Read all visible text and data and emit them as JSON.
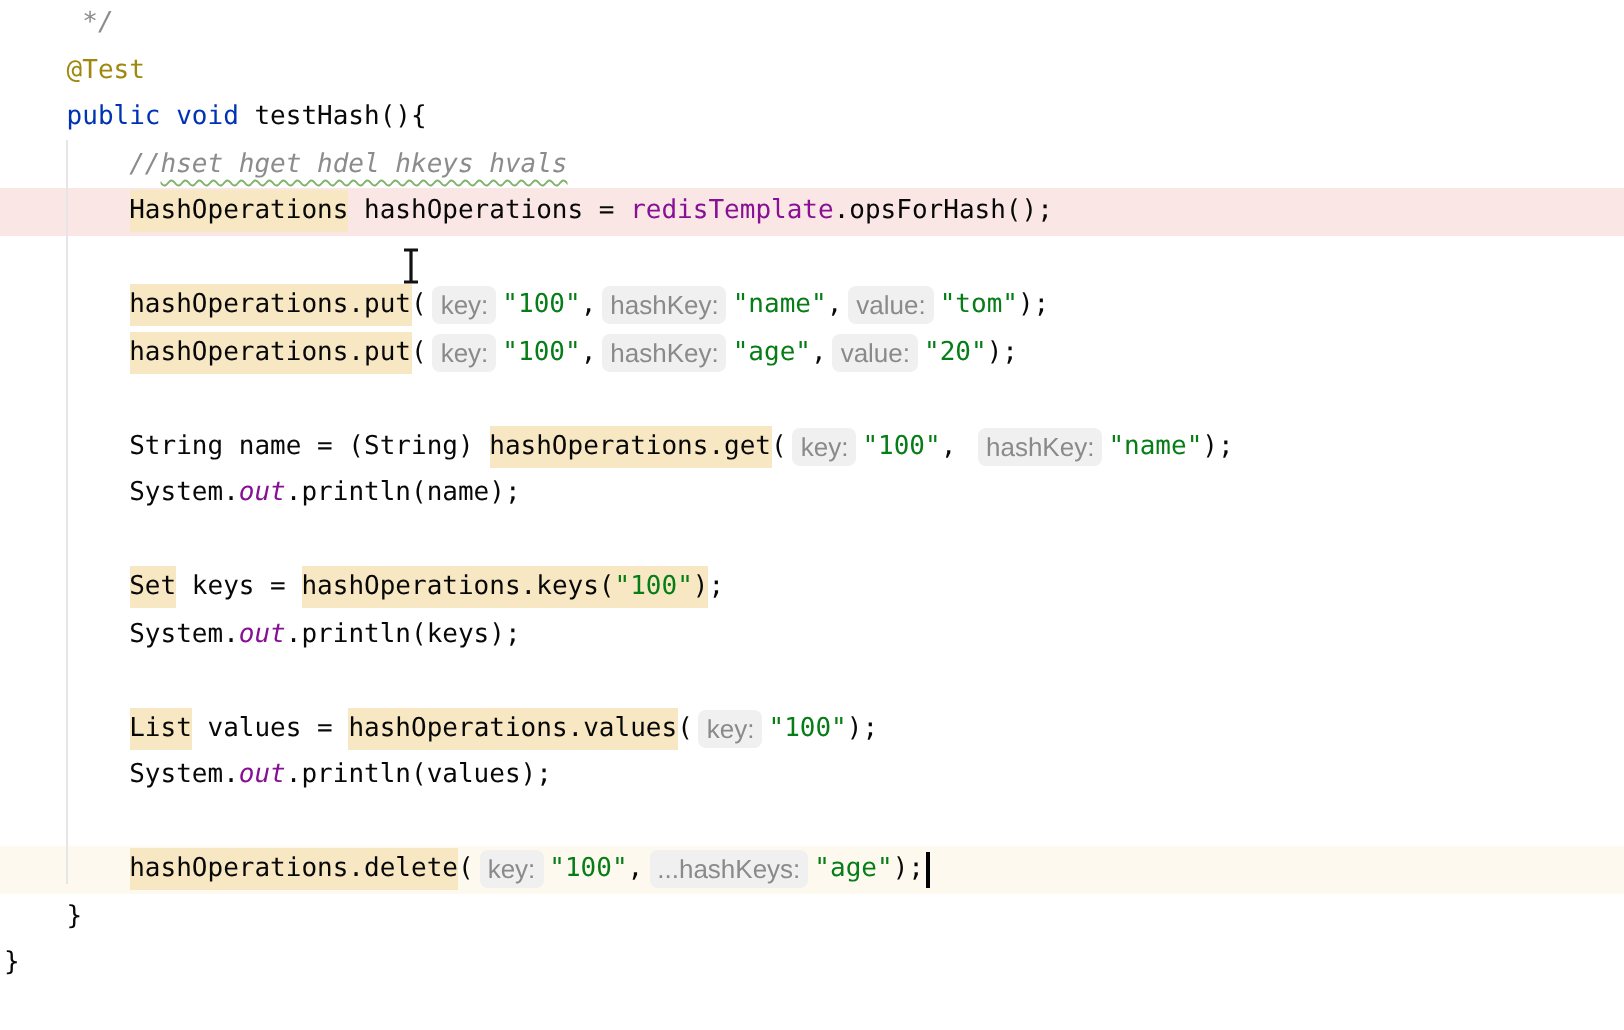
{
  "editor": {
    "members": [
      {
        "kind": "code",
        "tokens": [
          {
            "kind": "comment",
            "text": " */"
          }
        ]
      },
      {
        "kind": "code",
        "tokens": [
          {
            "kind": "annotation",
            "text": "@Test"
          }
        ]
      },
      {
        "kind": "code",
        "tokens": [
          {
            "kind": "keyword",
            "text": "public void"
          },
          {
            "kind": "plain",
            "text": " testHash(){"
          }
        ],
        "children": [
          {
            "kind": "code",
            "tokens": [
              {
                "kind": "comment",
                "text": "//"
              },
              {
                "kind": "comment-typo",
                "text": "hset hget hdel hkeys hvals"
              }
            ]
          },
          {
            "kind": "error-code",
            "tokens": [
              {
                "kind": "usage",
                "text": "HashOperations"
              },
              {
                "kind": "plain",
                "text": " hashOperations = "
              },
              {
                "kind": "field",
                "text": "redisTemplate"
              },
              {
                "kind": "plain",
                "text": ".opsForHash();"
              }
            ]
          },
          {
            "kind": "blank"
          },
          {
            "kind": "code",
            "tokens": [
              {
                "kind": "usage",
                "text": "hashOperations.put"
              },
              {
                "kind": "plain",
                "text": "("
              },
              {
                "kind": "hint",
                "text": "key:"
              },
              {
                "kind": "string",
                "text": "\"100\""
              },
              {
                "kind": "plain",
                "text": ","
              },
              {
                "kind": "hint",
                "text": "hashKey:"
              },
              {
                "kind": "string",
                "text": "\"name\""
              },
              {
                "kind": "plain",
                "text": ","
              },
              {
                "kind": "hint",
                "text": "value:"
              },
              {
                "kind": "string",
                "text": "\"tom\""
              },
              {
                "kind": "plain",
                "text": ");"
              }
            ]
          },
          {
            "kind": "code",
            "tokens": [
              {
                "kind": "usage",
                "text": "hashOperations.put"
              },
              {
                "kind": "plain",
                "text": "("
              },
              {
                "kind": "hint",
                "text": "key:"
              },
              {
                "kind": "string",
                "text": "\"100\""
              },
              {
                "kind": "plain",
                "text": ","
              },
              {
                "kind": "hint",
                "text": "hashKey:"
              },
              {
                "kind": "string",
                "text": "\"age\""
              },
              {
                "kind": "plain",
                "text": ","
              },
              {
                "kind": "hint",
                "text": "value:"
              },
              {
                "kind": "string",
                "text": "\"20\""
              },
              {
                "kind": "plain",
                "text": ");"
              }
            ]
          },
          {
            "kind": "blank"
          },
          {
            "kind": "code",
            "tokens": [
              {
                "kind": "plain",
                "text": "String name = (String) "
              },
              {
                "kind": "usage",
                "text": "hashOperations.get"
              },
              {
                "kind": "plain",
                "text": "("
              },
              {
                "kind": "hint",
                "text": "key:"
              },
              {
                "kind": "string",
                "text": "\"100\""
              },
              {
                "kind": "plain",
                "text": ", "
              },
              {
                "kind": "hint",
                "text": "hashKey:"
              },
              {
                "kind": "string",
                "text": "\"name\""
              },
              {
                "kind": "plain",
                "text": ");"
              }
            ]
          },
          {
            "kind": "code",
            "tokens": [
              {
                "kind": "plain",
                "text": "System."
              },
              {
                "kind": "static",
                "text": "out"
              },
              {
                "kind": "plain",
                "text": ".println(name);"
              }
            ]
          },
          {
            "kind": "blank"
          },
          {
            "kind": "code",
            "tokens": [
              {
                "kind": "usage",
                "text": "Set"
              },
              {
                "kind": "plain",
                "text": " keys = "
              },
              {
                "kind": "usage",
                "text": "hashOperations.keys("
              },
              {
                "kind": "usage-string",
                "text": "\"100\""
              },
              {
                "kind": "usage",
                "text": ")"
              },
              {
                "kind": "plain",
                "text": ";"
              }
            ]
          },
          {
            "kind": "code",
            "tokens": [
              {
                "kind": "plain",
                "text": "System."
              },
              {
                "kind": "static",
                "text": "out"
              },
              {
                "kind": "plain",
                "text": ".println(keys);"
              }
            ]
          },
          {
            "kind": "blank"
          },
          {
            "kind": "code",
            "tokens": [
              {
                "kind": "usage",
                "text": "List"
              },
              {
                "kind": "plain",
                "text": " values = "
              },
              {
                "kind": "usage",
                "text": "hashOperations.values"
              },
              {
                "kind": "plain",
                "text": "("
              },
              {
                "kind": "hint",
                "text": "key:"
              },
              {
                "kind": "string",
                "text": "\"100\""
              },
              {
                "kind": "plain",
                "text": ");"
              }
            ]
          },
          {
            "kind": "code",
            "tokens": [
              {
                "kind": "plain",
                "text": "System."
              },
              {
                "kind": "static",
                "text": "out"
              },
              {
                "kind": "plain",
                "text": ".println(values);"
              }
            ]
          },
          {
            "kind": "blank"
          },
          {
            "kind": "current-code",
            "tokens": [
              {
                "kind": "usage",
                "text": "hashOperations.delete"
              },
              {
                "kind": "plain",
                "text": "("
              },
              {
                "kind": "hint",
                "text": "key:"
              },
              {
                "kind": "string",
                "text": "\"100\""
              },
              {
                "kind": "plain",
                "text": ","
              },
              {
                "kind": "hint",
                "text": "...hashKeys:"
              },
              {
                "kind": "string",
                "text": "\"age\""
              },
              {
                "kind": "plain",
                "text": ");"
              }
            ]
          }
        ]
      },
      {
        "kind": "code",
        "tokens": [
          {
            "kind": "plain",
            "text": "}"
          }
        ]
      }
    ],
    "end_line": {
      "kind": "code",
      "tokens": [
        {
          "kind": "plain",
          "text": "}"
        }
      ]
    }
  }
}
